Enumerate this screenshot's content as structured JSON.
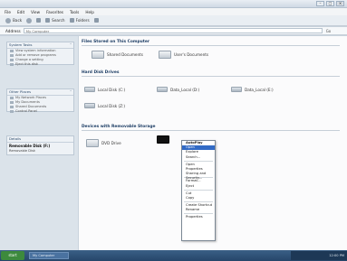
{
  "menubar": {
    "items": [
      "File",
      "Edit",
      "View",
      "Favorites",
      "Tools",
      "Help"
    ]
  },
  "toolbar": {
    "back": "Back",
    "search": "Search",
    "folders": "Folders"
  },
  "address": {
    "label": "Address",
    "value": "My Computer",
    "go": "Go"
  },
  "sidebar": {
    "system_tasks": {
      "title": "System Tasks",
      "items": [
        "View system information",
        "Add or remove programs",
        "Change a setting",
        "Eject this disk"
      ]
    },
    "other_places": {
      "title": "Other Places",
      "items": [
        "My Network Places",
        "My Documents",
        "Shared Documents",
        "Control Panel"
      ]
    },
    "details": {
      "title": "Details",
      "name": "Removable Disk (F:)",
      "type": "Removable Disk"
    }
  },
  "main": {
    "sections": {
      "files": "Files Stored on This Computer",
      "hard_drives": "Hard Disk Drives",
      "removable": "Devices with Removable Storage"
    },
    "folders": [
      "Shared Documents",
      "User's Documents"
    ],
    "hard_drives": [
      "Local Disk (C:)",
      "Data_Local (D:)",
      "Data_Local (E:)",
      "Local Disk (Z:)"
    ],
    "removable": [
      "DVD Drive"
    ]
  },
  "context_menu": {
    "items": [
      "AutoPlay",
      "Open",
      "Explore",
      "Search...",
      "Open",
      "Properties",
      "Sharing and Security...",
      "Format...",
      "Eject",
      "Cut",
      "Copy",
      "Create Shortcut",
      "Rename",
      "Properties"
    ]
  },
  "taskbar": {
    "start": "start",
    "task": "My Computer",
    "clock": "12:00 PM"
  }
}
